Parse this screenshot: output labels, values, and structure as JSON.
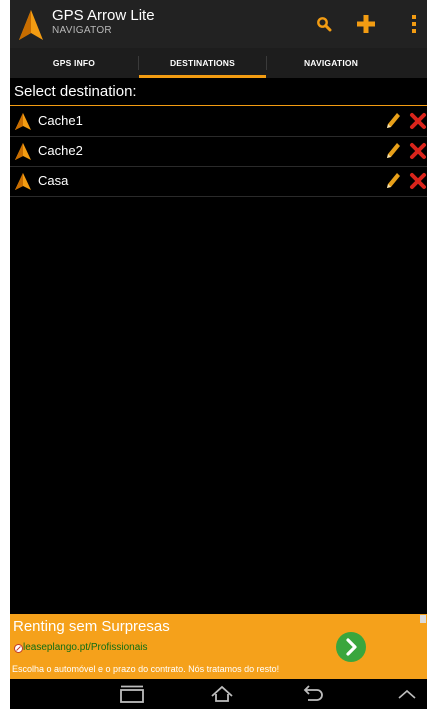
{
  "app": {
    "title": "GPS Arrow Lite",
    "subtitle": "NAVIGATOR",
    "logo_icon": "orange-arrow-icon"
  },
  "actionbar": {
    "search_icon": "search-icon",
    "add_icon": "plus-icon",
    "overflow_icon": "overflow-menu-icon"
  },
  "tabs": [
    {
      "label": "GPS INFO",
      "active": false
    },
    {
      "label": "DESTINATIONS",
      "active": true
    },
    {
      "label": "NAVIGATION",
      "active": false
    }
  ],
  "header": {
    "title": "Select destination:"
  },
  "destinations": [
    {
      "label": "Cache1",
      "edit_icon": "pencil-icon",
      "delete_icon": "delete-x-icon"
    },
    {
      "label": "Cache2",
      "edit_icon": "pencil-icon",
      "delete_icon": "delete-x-icon"
    },
    {
      "label": "Casa",
      "edit_icon": "pencil-icon",
      "delete_icon": "delete-x-icon"
    }
  ],
  "ad": {
    "title": "Renting sem Surpresas",
    "url": "leaseplango.pt/Profissionais",
    "text": "Escolha o automóvel e o prazo do contrato. Nós tratamos do resto!",
    "go_icon": "chevron-right-icon"
  },
  "navbar": {
    "recent_icon": "recent-apps-icon",
    "home_icon": "home-icon",
    "back_icon": "back-icon",
    "up_icon": "chevron-up-icon"
  },
  "colors": {
    "accent": "#f39c12",
    "ad_background": "#f5a11b",
    "delete": "#d9241b",
    "edit": "#e8a019"
  }
}
